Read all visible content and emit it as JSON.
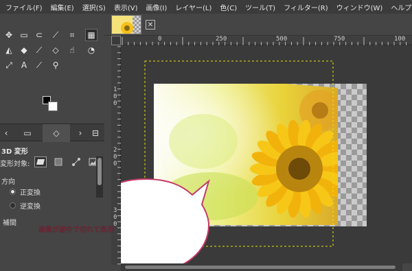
{
  "menubar": {
    "items": [
      "ファイル(F)",
      "編集(E)",
      "選択(S)",
      "表示(V)",
      "画像(I)",
      "レイヤー(L)",
      "色(C)",
      "ツール(T)",
      "フィルター(R)",
      "ウィンドウ(W)",
      "ヘルプ(H)"
    ]
  },
  "toolbox": {
    "tools": [
      {
        "name": "move-tool-icon",
        "glyph": "✥"
      },
      {
        "name": "rect-select-icon",
        "glyph": "▭"
      },
      {
        "name": "lasso-select-icon",
        "glyph": "⊂"
      },
      {
        "name": "fuzzy-select-icon",
        "glyph": "⟋"
      },
      {
        "name": "crop-tool-icon",
        "glyph": "⌗"
      },
      {
        "name": "3d-transform-icon",
        "glyph": "▦"
      },
      {
        "name": "bucket-fill-icon",
        "glyph": "◭"
      },
      {
        "name": "ink-tool-icon",
        "glyph": "◆"
      },
      {
        "name": "paintbrush-icon",
        "glyph": "⟋"
      },
      {
        "name": "eraser-icon",
        "glyph": "◇"
      },
      {
        "name": "smudge-icon",
        "glyph": "☝"
      },
      {
        "name": "dodge-burn-icon",
        "glyph": "◔"
      },
      {
        "name": "paths-tool-icon",
        "glyph": "⤢"
      },
      {
        "name": "text-tool-icon",
        "glyph": "A"
      },
      {
        "name": "color-picker-icon",
        "glyph": "⟋"
      },
      {
        "name": "zoom-tool-icon",
        "glyph": "⚲"
      }
    ]
  },
  "dock": {
    "tabs": [
      "‹",
      "▭",
      "◇",
      "›",
      "⊟"
    ]
  },
  "tool_options": {
    "title": "3D 変形",
    "transform_label": "変形対象:",
    "direction_label": "方向",
    "direction_options": [
      "正変換",
      "逆変換"
    ],
    "interpolation_label": "補間"
  },
  "canvas": {
    "ruler_ticks": [
      "0",
      "250",
      "500",
      "750",
      "100"
    ],
    "vertical_ticks": [
      "1",
      "0",
      "0",
      "2",
      "0",
      "0",
      "3",
      "0",
      "0"
    ]
  },
  "callout": {
    "text": "画像が途中で切れて表示"
  },
  "colors": {
    "menubar_bg": "#3b3b3b",
    "dock_bg": "#454545",
    "canvas_bg": "#3a3a3a",
    "selection_dash": "#e6e600",
    "callout_border": "#c33a6a",
    "callout_text": "#6b2233"
  }
}
